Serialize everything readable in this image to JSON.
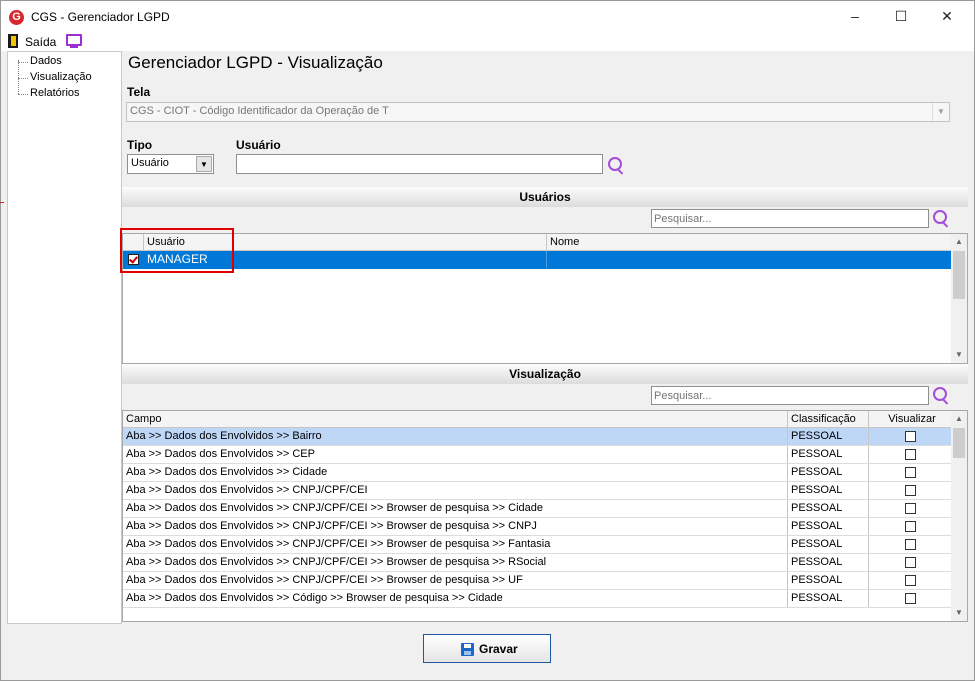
{
  "window": {
    "title": "CGS - Gerenciador LGPD",
    "logo_letter": "G",
    "controls": {
      "minimize": "‒",
      "maximize": "☐",
      "close": "✕"
    }
  },
  "menu": {
    "exit_label": "Saída",
    "exit_icon": "exit-door-icon",
    "monitor_icon": "monitor-icon"
  },
  "sidebar": {
    "items": [
      {
        "label": "Dados"
      },
      {
        "label": "Visualização"
      },
      {
        "label": "Relatórios"
      }
    ]
  },
  "page": {
    "title": "Gerenciador LGPD - Visualização"
  },
  "form": {
    "tela_label": "Tela",
    "tela_value": "CGS - CIOT - Código Identificador da Operação de T",
    "tipo_label": "Tipo",
    "tipo_value": "Usuário",
    "usuario_label": "Usuário",
    "usuario_value": ""
  },
  "users": {
    "header": "Usuários",
    "search_placeholder": "Pesquisar...",
    "columns": [
      "Usuário",
      "Nome"
    ],
    "rows": [
      {
        "usuario": "MANAGER",
        "nome": "",
        "checked": true
      }
    ]
  },
  "visualizacao": {
    "header": "Visualização",
    "search_placeholder": "Pesquisar...",
    "columns": [
      "Campo",
      "Classificação",
      "Visualizar"
    ],
    "rows": [
      {
        "campo": "Aba >> Dados dos Envolvidos >> Bairro",
        "classificacao": "PESSOAL",
        "visualizar": false
      },
      {
        "campo": "Aba >> Dados dos Envolvidos >> CEP",
        "classificacao": "PESSOAL",
        "visualizar": false
      },
      {
        "campo": "Aba >> Dados dos Envolvidos >> Cidade",
        "classificacao": "PESSOAL",
        "visualizar": false
      },
      {
        "campo": "Aba >> Dados dos Envolvidos >> CNPJ/CPF/CEI",
        "classificacao": "PESSOAL",
        "visualizar": false
      },
      {
        "campo": "Aba >> Dados dos Envolvidos >> CNPJ/CPF/CEI >> Browser de pesquisa >> Cidade",
        "classificacao": "PESSOAL",
        "visualizar": false
      },
      {
        "campo": "Aba >> Dados dos Envolvidos >> CNPJ/CPF/CEI >> Browser de pesquisa >> CNPJ",
        "classificacao": "PESSOAL",
        "visualizar": false
      },
      {
        "campo": "Aba >> Dados dos Envolvidos >> CNPJ/CPF/CEI >> Browser de pesquisa >> Fantasia",
        "classificacao": "PESSOAL",
        "visualizar": false
      },
      {
        "campo": "Aba >> Dados dos Envolvidos >> CNPJ/CPF/CEI >> Browser de pesquisa >> RSocial",
        "classificacao": "PESSOAL",
        "visualizar": false
      },
      {
        "campo": "Aba >> Dados dos Envolvidos >> CNPJ/CPF/CEI >> Browser de pesquisa >> UF",
        "classificacao": "PESSOAL",
        "visualizar": false
      },
      {
        "campo": "Aba >> Dados dos Envolvidos >> Código >> Browser de pesquisa >> Cidade",
        "classificacao": "PESSOAL",
        "visualizar": false
      }
    ]
  },
  "actions": {
    "save_label": "Gravar",
    "save_icon": "floppy-disk-icon"
  },
  "colors": {
    "selection": "#0078d7",
    "row_highlight": "#bfd7f7",
    "search_icon": "#a54dd9",
    "annotation": "#e00000"
  }
}
